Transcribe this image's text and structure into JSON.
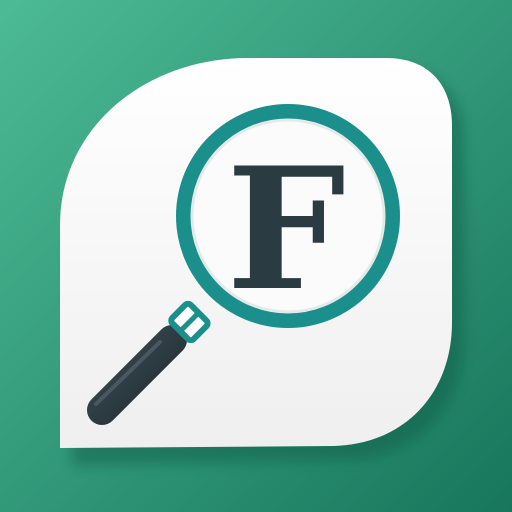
{
  "icon": {
    "letter": "F",
    "glyph_names": [
      "magnifying-glass-icon",
      "speech-bubble-icon"
    ],
    "colors": {
      "background_top": "#4dbb95",
      "background_bottom": "#17765c",
      "bubble": "#f7f7f7",
      "bubble_shadow": "#0d5a44",
      "lens_ring": "#1b8f8c",
      "lens_glass": "#fbfbfb",
      "handle": "#2f3e45",
      "letter": "#2a3b42"
    }
  }
}
